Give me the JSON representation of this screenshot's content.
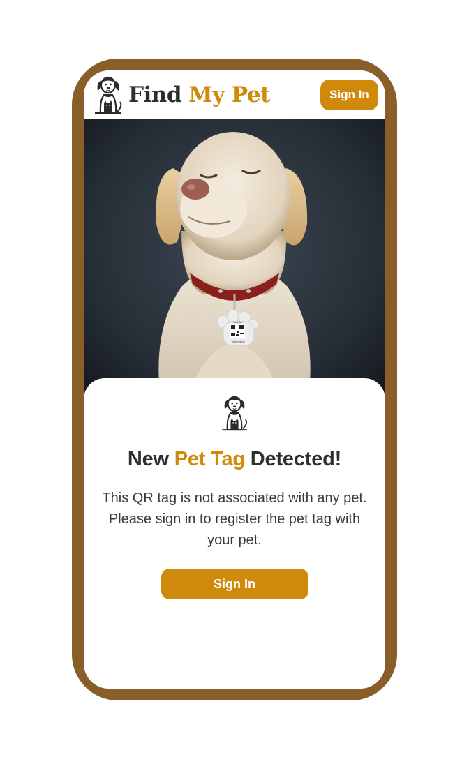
{
  "header": {
    "brand_find": "Find",
    "brand_accent": "My Pet",
    "signin_label": "Sign In"
  },
  "hero": {
    "tag_line1": "Scan Me",
    "tag_line2": "findmypet.io",
    "icon": "labrador-with-qr-tag-photo"
  },
  "card": {
    "icon": "dog-cat-logo-icon",
    "headline_part1": "New ",
    "headline_accent": "Pet Tag",
    "headline_part2": " Detected!",
    "message": "This QR tag is not associated with any pet. Please sign in to register the pet tag with your pet.",
    "signin_label": "Sign In"
  },
  "colors": {
    "accent": "#cf8a0c",
    "frame": "#8a5e29",
    "text_dark": "#2e2e2e"
  }
}
